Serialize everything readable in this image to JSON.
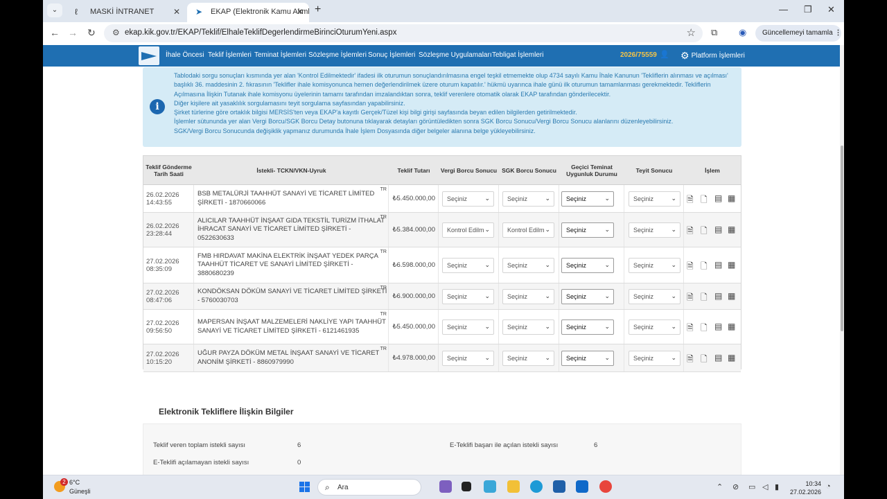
{
  "browser": {
    "tabs": [
      {
        "title": "MASKİ İNTRANET"
      },
      {
        "title": "EKAP (Elektronik Kamu Alımları"
      }
    ],
    "url": "ekap.kik.gov.tr/EKAP/Teklif/ElhaleTeklifDegerlendirmeBirinciOturumYeni.aspx",
    "update_label": "Güncellemeyi tamamla"
  },
  "site": {
    "menu": [
      "İhale Öncesi",
      "Teklif İşlemleri",
      "Teminat İşlemleri",
      "Sözleşme İşlemleri",
      "Sonuç İşlemleri",
      "Sözleşme Uygulamaları",
      "Tebligat İşlemleri"
    ],
    "ikn": "2026/75559",
    "platform_label": "Platform İşlemleri"
  },
  "info": {
    "paragraphs": [
      "Tablodaki sorgu sonuçları kısmında yer alan 'Kontrol Edilmektedir' ifadesi ilk oturumun sonuçlandırılmasına engel teşkil etmemekte olup 4734 sayılı Kamu İhale Kanunun 'Tekliflerin alınması ve açılması' başlıklı 36. maddesinin 2. fıkrasının 'Teklifler ihale komisyonunca hemen değerlendirilmek üzere oturum kapatılır.' hükmü uyarınca ihale günü ilk oturumun tamamlanması gerekmektedir. Tekliflerin Açılmasına İlişkin Tutanak ihale komisyonu üyelerinin tamamı tarafından imzalandıktan sonra, teklif verenlere otomatik olarak EKAP tarafından gönderilecektir.",
      "Diğer kişilere ait yasaklılık sorgulamasını teyit sorgulama sayfasından yapabilirsiniz.",
      "Şirket türlerine göre ortaklık bilgisi MERSİS'ten veya EKAP'a kayıtlı Gerçek/Tüzel kişi bilgi girişi sayfasında beyan edilen bilgilerden getirilmektedir.",
      "İşlemler sütununda yer alan Vergi Borcu/SGK Borcu Detay butonuna tıklayarak detayları görüntüledikten sonra SGK Borcu Sonucu/Vergi Borcu Sonucu alanlarını düzenleyebilirsiniz.",
      "SGK/Vergi Borcu Sonucunda değişiklik yapmanız durumunda İhale İşlem Dosyasında diğer belgeler alanına belge yükleyebilirsiniz."
    ]
  },
  "table": {
    "headers": {
      "date": "Teklif Gönderme Tarih Saati",
      "bidder": "İstekli- TCKN/VKN-Uyruk",
      "amount": "Teklif Tutarı",
      "tax": "Vergi Borcu Sonucu",
      "sgk": "SGK Borcu Sonucu",
      "guarantee": "Geçici Teminat Uygunluk Durumu",
      "confirm": "Teyit Sonucu",
      "ops": "İşlem"
    },
    "nationality": "TR",
    "rows": [
      {
        "date": "26.02.2026",
        "time": "14:43:55",
        "bidder": "BSB METALÜRJİ TAAHHÜT SANAYİ VE TİCARET LİMİTED ŞİRKETİ - 1870660066",
        "amount": "₺5.450.000,00",
        "tax": "Seçiniz",
        "sgk": "Seçiniz",
        "guarantee": "Seçiniz",
        "confirm": "Seçiniz"
      },
      {
        "date": "26.02.2026",
        "time": "23:28:44",
        "bidder": "ALICILAR TAAHHÜT İNŞAAT GIDA TEKSTİL TURİZM İTHALAT İHRACAT SANAYİ VE TİCARET LİMİTED ŞİRKETİ - 0522630633",
        "amount": "₺5.384.000,00",
        "tax": "Kontrol Edilm",
        "sgk": "Kontrol Edilm",
        "guarantee": "Seçiniz",
        "confirm": "Seçiniz"
      },
      {
        "date": "27.02.2026",
        "time": "08:35:09",
        "bidder": "FMB HIRDAVAT MAKİNA ELEKTRİK İNŞAAT YEDEK PARÇA TAAHHÜT TİCARET VE SANAYİ LİMİTED ŞİRKETİ - 3880680239",
        "amount": "₺6.598.000,00",
        "tax": "Seçiniz",
        "sgk": "Seçiniz",
        "guarantee": "Seçiniz",
        "confirm": "Seçiniz"
      },
      {
        "date": "27.02.2026",
        "time": "08:47:06",
        "bidder": "KONDÖKSAN DÖKÜM SANAYİ VE TİCARET LİMİTED ŞİRKETİ - 5760030703",
        "amount": "₺6.900.000,00",
        "tax": "Seçiniz",
        "sgk": "Seçiniz",
        "guarantee": "Seçiniz",
        "confirm": "Seçiniz"
      },
      {
        "date": "27.02.2026",
        "time": "09:56:50",
        "bidder": "MAPERSAN İNŞAAT MALZEMELERİ NAKLİYE YAPI TAAHHÜT SANAYİ VE TİCARET LİMİTED ŞİRKETİ - 6121461935",
        "amount": "₺5.450.000,00",
        "tax": "Seçiniz",
        "sgk": "Seçiniz",
        "guarantee": "Seçiniz",
        "confirm": "Seçiniz"
      },
      {
        "date": "27.02.2026",
        "time": "10:15:20",
        "bidder": "UĞUR PAYZA DÖKÜM METAL İNŞAAT SANAYİ VE TİCARET ANONİM ŞİRKETİ - 8860979990",
        "amount": "₺4.978.000,00",
        "tax": "Seçiniz",
        "sgk": "Seçiniz",
        "guarantee": "Seçiniz",
        "confirm": "Seçiniz"
      }
    ]
  },
  "summary": {
    "title": "Elektronik Tekliflere İlişkin Bilgiler",
    "total_label": "Teklif veren toplam istekli sayısı",
    "total_value": "6",
    "success_label": "E-Teklifi başarı ile açılan istekli sayısı",
    "success_value": "6",
    "failed_label": "E-Teklifi açılamayan istekli sayısı",
    "failed_value": "0"
  },
  "taskbar": {
    "weather_badge": "2",
    "temp": "6°C",
    "weather": "Güneşli",
    "search_placeholder": "Ara",
    "time": "10:34",
    "date": "27.02.2026"
  },
  "colors": {
    "site_header": "#1f6fb2",
    "info_bg": "#d5ebf6",
    "info_text": "#2a7ab0",
    "ikn": "#f6c445"
  }
}
